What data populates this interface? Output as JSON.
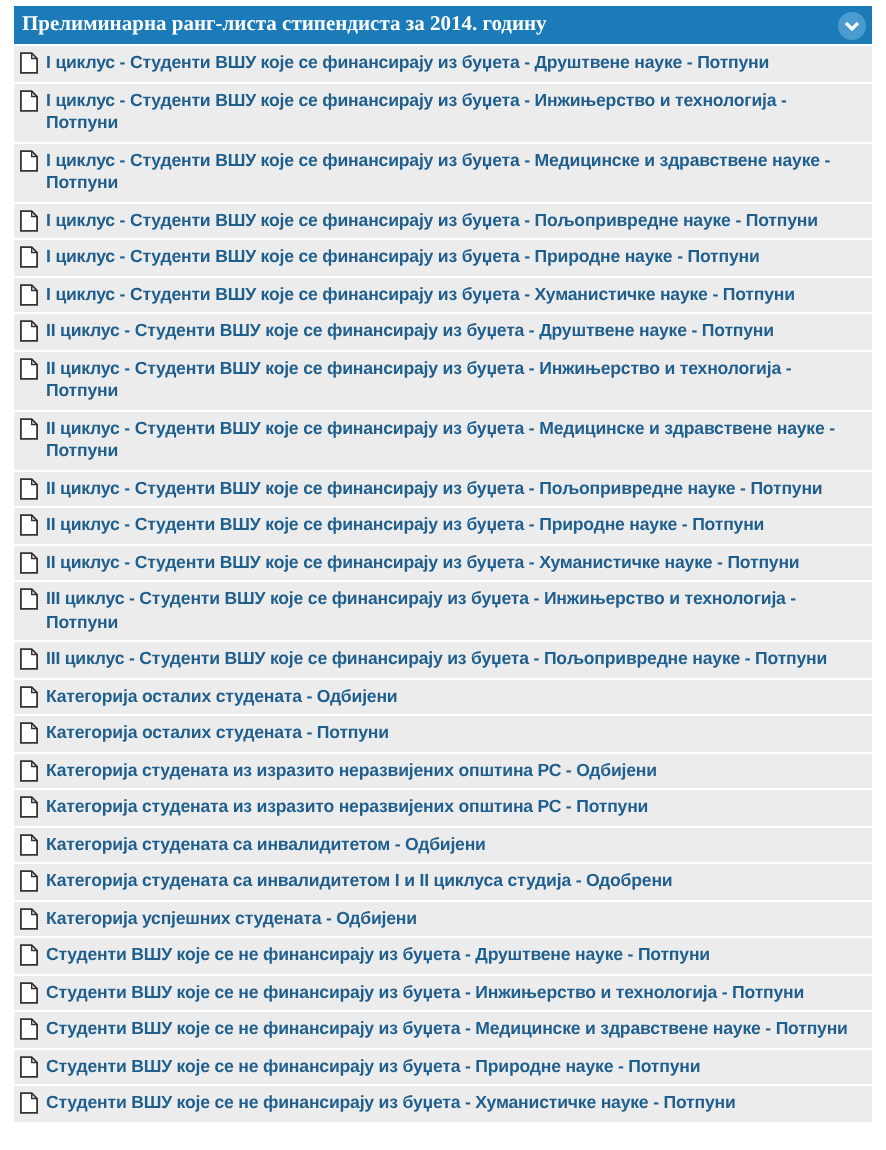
{
  "panel": {
    "title": "Прелиминарна ранг-листа стипендиста за 2014. годину",
    "expanded": true,
    "items": [
      "I циклус - Студенти ВШУ које се финансирају из буџета - Друштвене науке - Потпуни",
      "I циклус - Студенти ВШУ које се финансирају из буџета - Инжињерство и технологија - Потпуни",
      "I циклус - Студенти ВШУ које се финансирају из буџета - Медицинске и здравствене науке - Потпуни",
      "I циклус - Студенти ВШУ које се финансирају из буџета - Пољопривредне науке - Потпуни",
      "I циклус - Студенти ВШУ које се финансирају из буџета - Природне науке - Потпуни",
      "I циклус - Студенти ВШУ које се финансирају из буџета - Хуманистичке науке - Потпуни",
      "II циклус - Студенти ВШУ које се финансирају из буџета - Друштвене науке - Потпуни",
      "II циклус - Студенти ВШУ које се финансирају из буџета - Инжињерство и технологија - Потпуни",
      "II циклус - Студенти ВШУ које се финансирају из буџета - Медицинске и здравствене науке - Потпуни",
      "II циклус - Студенти ВШУ које се финансирају из буџета - Пољопривредне науке - Потпуни",
      "II циклус - Студенти ВШУ које се финансирају из буџета - Природне науке - Потпуни",
      "II циклус - Студенти ВШУ које се финансирају из буџета - Хуманистичке науке - Потпуни",
      "III циклус - Студенти ВШУ које се финансирају из буџета - Инжињерство и технологија - Потпуни",
      "III циклус - Студенти ВШУ које се финансирају из буџета - Пољопривредне науке - Потпуни",
      "Категорија осталих студената - Одбијени",
      "Категорија осталих студената - Потпуни",
      "Категорија студената из изразито неразвијених општина РС - Одбијени",
      "Категорија студената из изразито неразвијених општина РС - Потпуни",
      "Категорија студената са инвалидитетом - Одбијени",
      "Категорија студената са инвалидитетом I и II циклуса студија - Одобрени",
      "Категорија успјешних студената - Одбијени",
      "Студенти ВШУ које се не финансирају из буџета - Друштвене науке - Потпуни",
      "Студенти ВШУ које се не финансирају из буџета - Инжињерство и технологија - Потпуни",
      "Студенти ВШУ које се не финансирају из буџета - Медицинске и здравствене науке - Потпуни",
      "Студенти ВШУ које се не финансирају из буџета - Природне науке - Потпуни",
      "Студенти ВШУ које се не финансирају из буџета - Хуманистичке науке - Потпуни"
    ]
  }
}
